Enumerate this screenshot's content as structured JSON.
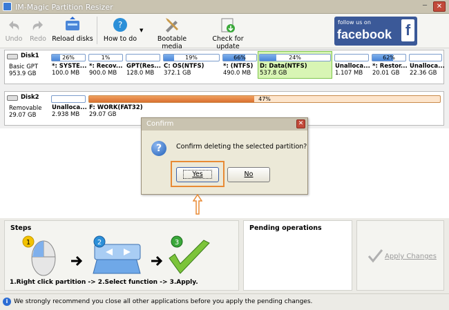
{
  "window": {
    "title": "IM-Magic Partition Resizer",
    "minimize": "─",
    "close": "✕"
  },
  "toolbar": {
    "undo": "Undo",
    "redo": "Redo",
    "reload": "Reload disks",
    "howto": "How to do",
    "bootable": "Bootable media",
    "update": "Check for update",
    "facebook": {
      "follow": "follow us on",
      "brand": "facebook",
      "f": "f"
    }
  },
  "disk1": {
    "name": "Disk1",
    "type": "Basic GPT",
    "size": "953.9 GB",
    "partitions": [
      {
        "pct": "26%",
        "usage": 0.26,
        "name": "*: SYSTE...",
        "size": "100.0 MB"
      },
      {
        "pct": "1%",
        "usage": 0.01,
        "name": "*: Recov...",
        "size": "900.0 MB"
      },
      {
        "pct": "",
        "usage": 0.0,
        "name": "GPT(Res...",
        "size": "128.0 MB"
      },
      {
        "pct": "19%",
        "usage": 0.19,
        "name": "C: OS(NTFS)",
        "size": "372.1 GB"
      },
      {
        "pct": "66%",
        "usage": 0.66,
        "name": "*: (NTFS)",
        "size": "490.0 MB"
      },
      {
        "pct": "24%",
        "usage": 0.24,
        "name": "D: Data(NTFS)",
        "size": "537.8 GB",
        "selected": true
      },
      {
        "pct": "",
        "usage": 0.0,
        "name": "Unalloca...",
        "size": "1.107 MB"
      },
      {
        "pct": "62%",
        "usage": 0.62,
        "name": "*: Restor...",
        "size": "20.01 GB"
      },
      {
        "pct": "",
        "usage": 0.0,
        "name": "Unalloca...",
        "size": "22.36 GB"
      }
    ]
  },
  "disk2": {
    "name": "Disk2",
    "type": "Removable",
    "size": "29.07 GB",
    "partitions": [
      {
        "pct": "",
        "usage": 0.0,
        "name": "Unalloca...",
        "size": "2.938 MB"
      },
      {
        "pct": "47%",
        "usage": 0.47,
        "name": "F: WORK(FAT32)",
        "size": "29.07 GB"
      }
    ]
  },
  "dialog": {
    "title": "Confirm",
    "close": "✕",
    "icon": "?",
    "message": "Confirm deleting the selected partition?",
    "yes": "Yes",
    "no": "No"
  },
  "steps": {
    "heading": "Steps",
    "step1": "1",
    "step2": "2",
    "step3": "3",
    "caption": "1.Right click partition -> 2.Select function -> 3.Apply."
  },
  "pending": {
    "heading": "Pending operations"
  },
  "apply": {
    "label": "Apply Changes"
  },
  "status": {
    "icon": "i",
    "text": "We strongly recommend you close all other applications before you apply the pending changes."
  },
  "colors": {
    "accent": "#4a86d8",
    "selected": "#d8f5b4",
    "highlight": "#e88a34",
    "facebook": "#3b5998"
  }
}
